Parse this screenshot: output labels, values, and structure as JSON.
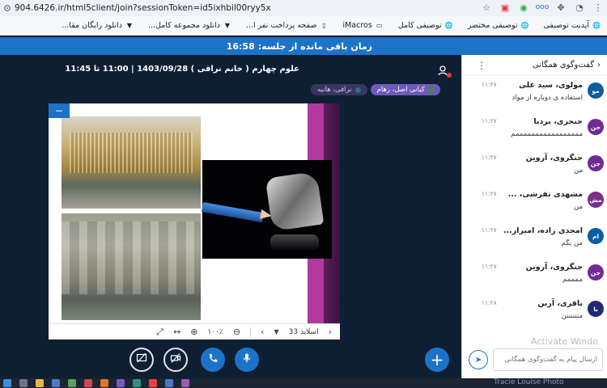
{
  "browser": {
    "url": "904.6426.ir/html5client/join?sessionToken=id5ixhbil00ryy5x"
  },
  "bookmarks": [
    {
      "label": "آپدیت توصیفی",
      "icon": "globe-icon"
    },
    {
      "label": "توصیفی مختصر",
      "icon": "globe-icon"
    },
    {
      "label": "توصیفی کامل",
      "icon": "globe-icon"
    },
    {
      "label": "iMacros",
      "icon": "folder-icon"
    },
    {
      "label": "صفحه پرداخت نفر ا...",
      "icon": "page-icon"
    },
    {
      "label": "دانلود مجموعه کامل...",
      "icon": "download-icon"
    },
    {
      "label": "دانلود رایگان مقا...",
      "icon": "download-icon"
    }
  ],
  "timer": {
    "label": "زمان باقی مانده از جلسه:",
    "value": "16:58"
  },
  "session": {
    "title": "علوم چهارم ( خانم نراقی ) 1403/09/28 | 11:00 تا 11:45",
    "tabs": [
      {
        "label": "کیانی اصل، رهام",
        "active": true
      },
      {
        "label": "نراقی، هانیه",
        "active": false
      }
    ]
  },
  "slide_toolbar": {
    "slide_label": "اسلاید 33",
    "zoom": "۱۰۰٪"
  },
  "chat": {
    "title": "گفت‌وگوی همگانی",
    "placeholder": "ارسال پیام به گفت‌وگوی همگانی",
    "messages": [
      {
        "initials": "مو",
        "name": "مولوی، سید علی",
        "time": "۱۱:۲۷",
        "text": "استفاده ی دوباره از مواد",
        "color": "#0b5d9f"
      },
      {
        "initials": "جن",
        "name": "حنجری، بردیا",
        "time": "۱۱:۲۷",
        "text": "مممممممممممممممممم",
        "color": "#6f2b96"
      },
      {
        "initials": "جن",
        "name": "جنگروی، آروین",
        "time": "۱۱:۲۷",
        "text": "من",
        "color": "#6f2b96"
      },
      {
        "initials": "مش",
        "name": "مشهدی تفرشی، ...",
        "time": "۱۱:۲۷",
        "text": "من",
        "color": "#7b2e8a"
      },
      {
        "initials": "ام",
        "name": "امجدی زاده، امیرار...",
        "time": "۱۱:۲۷",
        "text": "من بگم",
        "color": "#0b5d9f"
      },
      {
        "initials": "جن",
        "name": "جنگروی، آروین",
        "time": "۱۱:۲۷",
        "text": "ممممم",
        "color": "#6f2b96"
      },
      {
        "initials": "با",
        "name": "باقری، آرین",
        "time": "۱۱:۲۸",
        "text": "مننننننن",
        "color": "#1f2b70"
      }
    ]
  },
  "watermark": "Activate Windo",
  "taskbar": {
    "text": "Tracie Louise Photo"
  }
}
